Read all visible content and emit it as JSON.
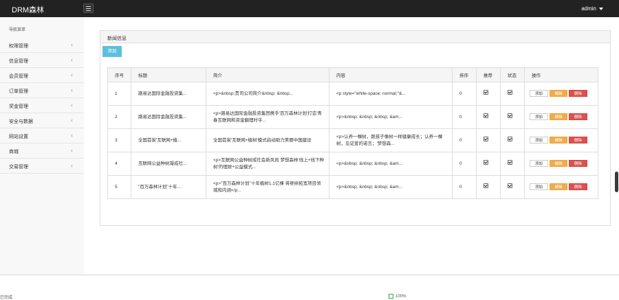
{
  "app": {
    "brand": "DRM森林",
    "user": "admin"
  },
  "sidebar": {
    "header": "导航菜单",
    "items": [
      {
        "label": "权限管理"
      },
      {
        "label": "信息管理"
      },
      {
        "label": "会员管理"
      },
      {
        "label": "订单管理"
      },
      {
        "label": "奖金管理"
      },
      {
        "label": "安全与数据"
      },
      {
        "label": "网站设置"
      },
      {
        "label": "商城"
      },
      {
        "label": "交易管理"
      }
    ]
  },
  "panel": {
    "title": "新闻信息",
    "add_label": "添加"
  },
  "table": {
    "headers": {
      "index": "序号",
      "title": "标题",
      "summary": "简介",
      "content": "内容",
      "sort": "排序",
      "recommend": "推荐",
      "status": "状态",
      "actions": "操作"
    },
    "action_labels": {
      "add": "添加",
      "edit": "编辑",
      "delete": "删除"
    },
    "rows": [
      {
        "index": "1",
        "title": "路易达国际金融投资集...",
        "summary": "<p>&nbsp;贵司公司简介&nbsp; &nbsp...",
        "content": "<p style=\"white-space: normal;\"&...",
        "sort": "0",
        "recommend": true,
        "status": true
      },
      {
        "index": "2",
        "title": "路易达国际金融投资集...",
        "summary": "<p>路易达国际金融投资集团携手'百万森林计划'打造'青春互联网和资金翻理时乎...",
        "content": "<p>&nbsp; &nbsp; &nbsp; &am...",
        "sort": "0",
        "recommend": true,
        "status": true
      },
      {
        "index": "3",
        "title": "全国首家'互联网+植...",
        "summary": "全国首家'互联网+植树'模式启动助力美丽中国建设",
        "content": "<p>认养一棵树，跟孩子像树一样健康成长；认养一棵树，见证爱的诺言；'梦想森...",
        "sort": "0",
        "recommend": true,
        "status": true
      },
      {
        "index": "4",
        "title": "互联网公益种树凝成社...",
        "summary": "<p>互联网公益种树成社会新风尚 梦想森林'线上+线下种树'的理财+公益模式...",
        "content": "<p>&nbsp; &nbsp; &nbsp; &am...",
        "sort": "0",
        "recommend": true,
        "status": true
      },
      {
        "index": "5",
        "title": "\"百万森林计划\"十年...",
        "summary": "<p>\"百万森林计划\"十年植树1.1亿棵 将继续拓宽项目领域和内涵</p...",
        "content": "<p>&nbsp; &nbsp; &nbsp; &am...",
        "sort": "0",
        "recommend": true,
        "status": true
      }
    ]
  },
  "statusbar": {
    "left": "已完成",
    "right": "100%"
  }
}
